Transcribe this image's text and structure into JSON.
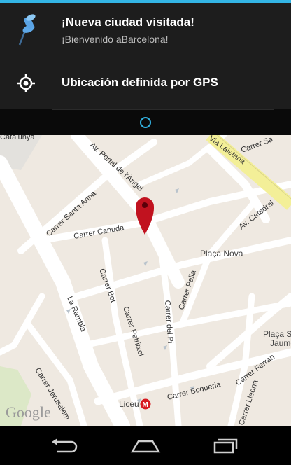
{
  "notifications": [
    {
      "title": "¡Nueva ciudad visitada!",
      "subtitle": "¡Bienvenido aBarcelona!",
      "icon": "pushpin-icon"
    },
    {
      "title": "Ubicación definida por GPS",
      "icon": "gps-target-icon"
    }
  ],
  "map": {
    "streets": {
      "catalunya": "Catalunya",
      "portal_angel": "Av. Portal de l'Àngel",
      "via_laietana": "Via Laietana",
      "carrer_sa": "Carrer Sa",
      "santa_anna": "Carrer Santa Anna",
      "canuda": "Carrer Canuda",
      "av_catedral": "Av. Catedral",
      "placa_nova": "Plaça Nova",
      "bot": "Carrer Bot",
      "palla": "Carrer Palla",
      "la_rambla": "La Rambla",
      "petritxol": "Carrer Petritxol",
      "del_pi": "Carrer del Pi",
      "placa_sant_jaume": "Plaça Sa",
      "jaume": "Jaume",
      "boqueria": "Carrer Boqueria",
      "ferran": "Carrer Ferran",
      "jerusalem": "Carrer Jerusalem",
      "lleona": "Carrer Lleona",
      "liceu": "Liceu"
    },
    "metro_symbol": "M",
    "logo": "Google"
  },
  "colors": {
    "accent": "#33b5e5",
    "pin": "#c1121f",
    "highlight_road": "#f8f39a"
  },
  "navbar": {
    "back": "back-icon",
    "home": "home-icon",
    "recents": "recent-apps-icon"
  }
}
